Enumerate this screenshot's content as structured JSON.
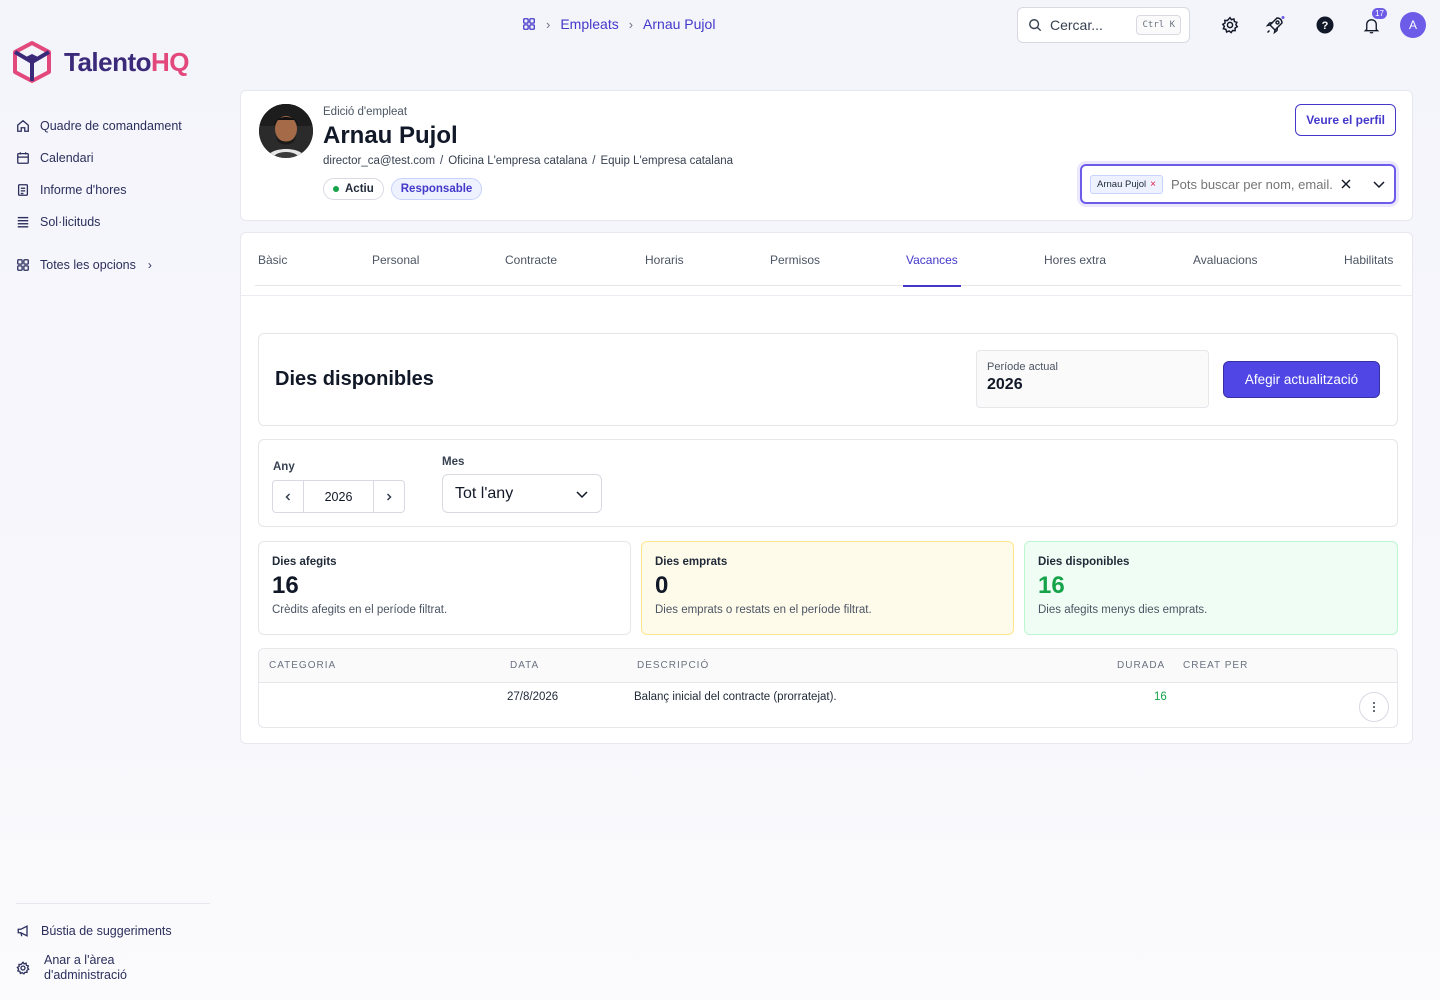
{
  "app": {
    "brand_part1": "Talento",
    "brand_part2": "HQ"
  },
  "sidebar": {
    "items": [
      {
        "label": "Quadre de comandament",
        "icon": "home-icon"
      },
      {
        "label": "Calendari",
        "icon": "calendar-icon"
      },
      {
        "label": "Informe d'hores",
        "icon": "report-icon"
      },
      {
        "label": "Sol·licituds",
        "icon": "list-icon"
      }
    ],
    "all_options": "Totes les opcions",
    "bottom": {
      "suggestions": "Bústia de suggeriments",
      "admin_line1": "Anar a l'àrea",
      "admin_line2": "d'administració"
    }
  },
  "breadcrumb": {
    "items": [
      "Empleats",
      "Arnau Pujol"
    ]
  },
  "search": {
    "placeholder": "Cercar...",
    "shortcut": "Ctrl K"
  },
  "notifications": {
    "count": "17"
  },
  "user": {
    "initial": "A"
  },
  "employee": {
    "eyebrow": "Edició d'empleat",
    "name": "Arnau Pujol",
    "email": "director_ca@test.com",
    "office": "Oficina L'empresa catalana",
    "team": "Equip L'empresa catalana",
    "status": "Actiu",
    "role": "Responsable",
    "view_profile": "Veure el perfil",
    "picker_chip": "Arnau Pujol",
    "picker_placeholder": "Pots buscar per nom, email..."
  },
  "tabs": [
    {
      "label": "Bàsic"
    },
    {
      "label": "Personal"
    },
    {
      "label": "Contracte"
    },
    {
      "label": "Horaris"
    },
    {
      "label": "Permisos"
    },
    {
      "label": "Vacances",
      "active": true
    },
    {
      "label": "Hores extra"
    },
    {
      "label": "Avaluacions"
    },
    {
      "label": "Habilitats"
    }
  ],
  "vacations": {
    "title": "Dies disponibles",
    "period_label": "Període actual",
    "period_value": "2026",
    "add_button": "Afegir actualització",
    "year_label": "Any",
    "year_value": "2026",
    "month_label": "Mes",
    "month_value": "Tot l'any",
    "stats": {
      "added": {
        "label": "Dies afegits",
        "value": "16",
        "desc": "Crèdits afegits en el període filtrat."
      },
      "taken": {
        "label": "Dies emprats",
        "value": "0",
        "desc": "Dies emprats o restats en el període filtrat."
      },
      "available": {
        "label": "Dies disponibles",
        "value": "16",
        "desc": "Dies afegits menys dies emprats."
      }
    },
    "table": {
      "headers": [
        "CATEGORIA",
        "DATA",
        "DESCRIPCIÓ",
        "DURADA",
        "CREAT PER"
      ],
      "rows": [
        {
          "category": "",
          "date": "27/8/2026",
          "description": "Balanç inicial del contracte (prorratejat).",
          "duration": "16",
          "created_by": ""
        }
      ]
    }
  },
  "colors": {
    "accent": "#4f46e5",
    "brand_pink": "#e2487b",
    "brand_navy": "#3b2a7a",
    "success": "#16a34a"
  }
}
